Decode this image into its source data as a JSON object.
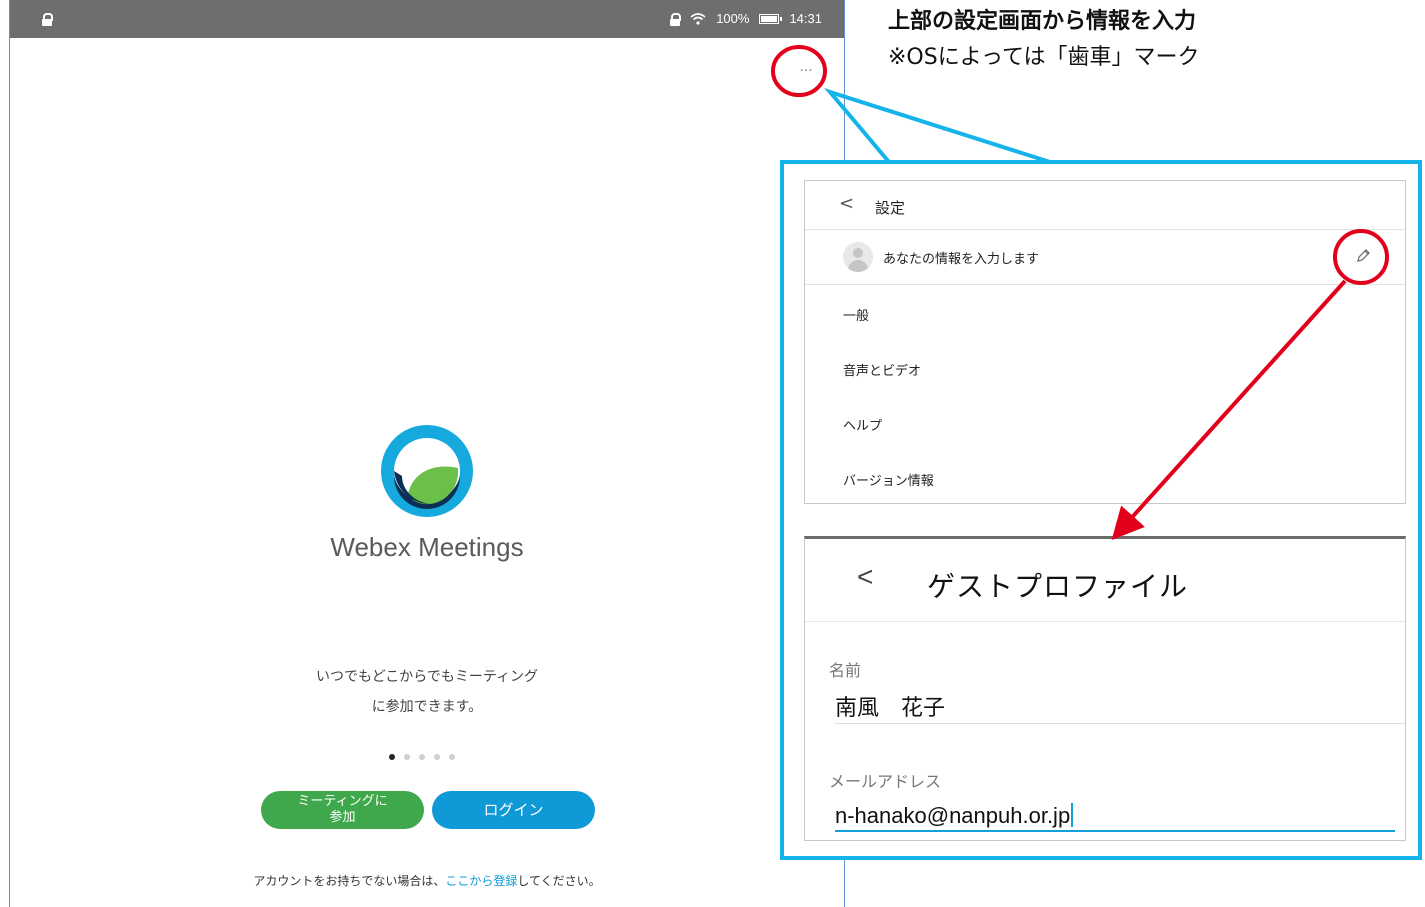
{
  "status_bar": {
    "battery": "100%",
    "time": "14:31"
  },
  "main": {
    "more_label": "...",
    "app_name": "Webex Meetings",
    "tagline_line1": "いつでもどこからでもミーティング",
    "tagline_line2": "に参加できます。",
    "join_label_line1": "ミーティングに",
    "join_label_line2": "参加",
    "login_label": "ログイン",
    "signup_prefix": "アカウントをお持ちでない場合は、",
    "signup_link": "ここから登録",
    "signup_suffix": "してください。",
    "carousel_pages": 5,
    "carousel_active": 1
  },
  "annotation": {
    "title": "上部の設定画面から情報を入力",
    "subtitle": "※OSによっては「歯車」マーク"
  },
  "settings": {
    "back_label": "<",
    "title": "設定",
    "user_prompt": "あなたの情報を入力します",
    "items": [
      {
        "label": "一般"
      },
      {
        "label": "音声とビデオ"
      },
      {
        "label": "ヘルプ"
      },
      {
        "label": "バージョン情報"
      }
    ]
  },
  "profile": {
    "back_label": "<",
    "title": "ゲストプロファイル",
    "name_label": "名前",
    "name_value": "南風　花子",
    "email_label": "メールアドレス",
    "email_value": "n-hanako@nanpuh.or.jp"
  },
  "colors": {
    "highlight_circle": "#e2001a",
    "callout_border": "#14b4ea",
    "join_button": "#3fa84c",
    "login_button": "#0f9ad7",
    "status_bar": "#6e6e6e"
  },
  "icons": [
    "lock-icon",
    "wifi-icon",
    "battery-icon",
    "more-icon",
    "back-icon",
    "avatar-icon",
    "edit-pencil-icon",
    "webex-logo"
  ]
}
